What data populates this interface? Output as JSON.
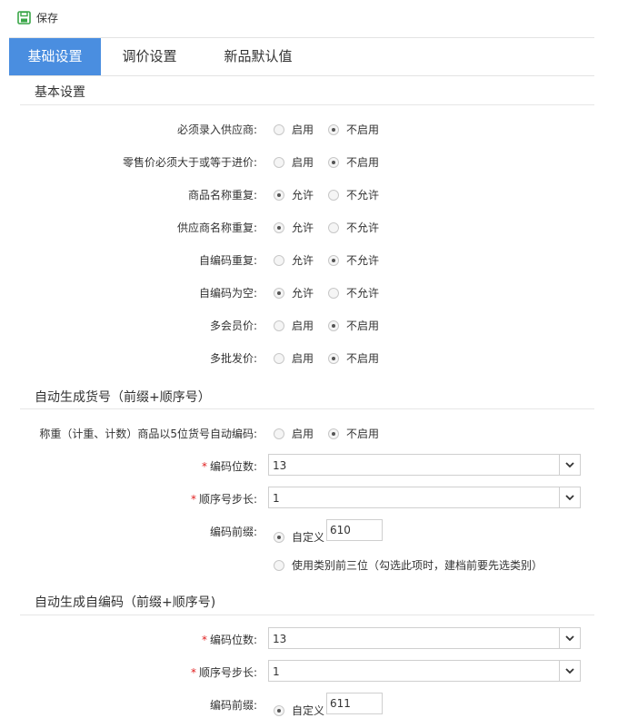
{
  "toolbar": {
    "save_label": "保存"
  },
  "tabs": [
    {
      "label": "基础设置",
      "active": true
    },
    {
      "label": "调价设置",
      "active": false
    },
    {
      "label": "新品默认值",
      "active": false
    }
  ],
  "basic": {
    "title": "基本设置",
    "rows": [
      {
        "label": "必须录入供应商:",
        "opt1": "启用",
        "opt2": "不启用",
        "selected": 2
      },
      {
        "label": "零售价必须大于或等于进价:",
        "opt1": "启用",
        "opt2": "不启用",
        "selected": 2
      },
      {
        "label": "商品名称重复:",
        "opt1": "允许",
        "opt2": "不允许",
        "selected": 1
      },
      {
        "label": "供应商名称重复:",
        "opt1": "允许",
        "opt2": "不允许",
        "selected": 1
      },
      {
        "label": "自编码重复:",
        "opt1": "允许",
        "opt2": "不允许",
        "selected": 2
      },
      {
        "label": "自编码为空:",
        "opt1": "允许",
        "opt2": "不允许",
        "selected": 1
      },
      {
        "label": "多会员价:",
        "opt1": "启用",
        "opt2": "不启用",
        "selected": 2
      },
      {
        "label": "多批发价:",
        "opt1": "启用",
        "opt2": "不启用",
        "selected": 2
      }
    ]
  },
  "auto_item_no": {
    "title": "自动生成货号（前缀+顺序号）",
    "weigh": {
      "label": "称重（计重、计数）商品以5位货号自动编码:",
      "opt1": "启用",
      "opt2": "不启用",
      "selected": 2
    },
    "digits": {
      "required": "*",
      "label": "编码位数:",
      "value": "13"
    },
    "step": {
      "required": "*",
      "label": "顺序号步长:",
      "value": "1"
    },
    "prefix": {
      "label": "编码前缀:",
      "custom_label": "自定义",
      "custom_value": "610",
      "category_label": "使用类别前三位（勾选此项时，建档前要先选类别）",
      "selected": "custom"
    }
  },
  "auto_self_code": {
    "title": "自动生成自编码（前缀+顺序号)",
    "digits": {
      "required": "*",
      "label": "编码位数:",
      "value": "13"
    },
    "step": {
      "required": "*",
      "label": "顺序号步长:",
      "value": "1"
    },
    "prefix": {
      "label": "编码前缀:",
      "custom_label": "自定义",
      "custom_value": "611",
      "selected": "custom"
    }
  }
}
